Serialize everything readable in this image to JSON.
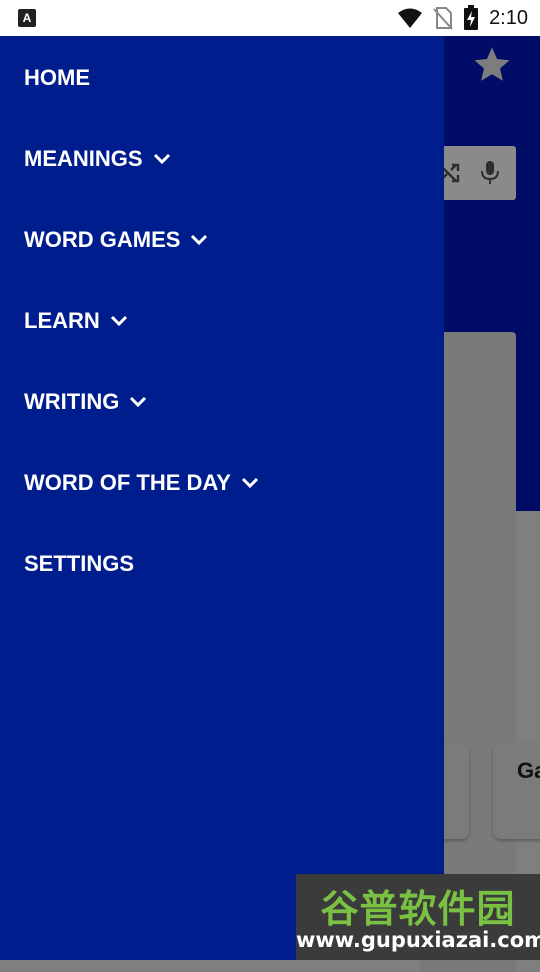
{
  "status_bar": {
    "app_badge": "A",
    "time": "2:10",
    "icons": [
      "wifi-icon",
      "no-sim-icon",
      "battery-charging-icon"
    ]
  },
  "app_background": {
    "header_color": "#000c66",
    "star_icon": "star-icon",
    "search_icons": [
      "shuffle-icon",
      "mic-icon"
    ],
    "tile_label": "Ga"
  },
  "drawer": {
    "background": "#001d8e",
    "items": [
      {
        "label": "HOME",
        "expandable": false
      },
      {
        "label": "MEANINGS",
        "expandable": true
      },
      {
        "label": "WORD GAMES",
        "expandable": true
      },
      {
        "label": "LEARN",
        "expandable": true
      },
      {
        "label": "WRITING",
        "expandable": true
      },
      {
        "label": "WORD OF THE DAY",
        "expandable": true
      },
      {
        "label": "SETTINGS",
        "expandable": false
      }
    ]
  },
  "watermark": {
    "title": "谷普软件园",
    "url": "www.gupuxiazai.com"
  }
}
